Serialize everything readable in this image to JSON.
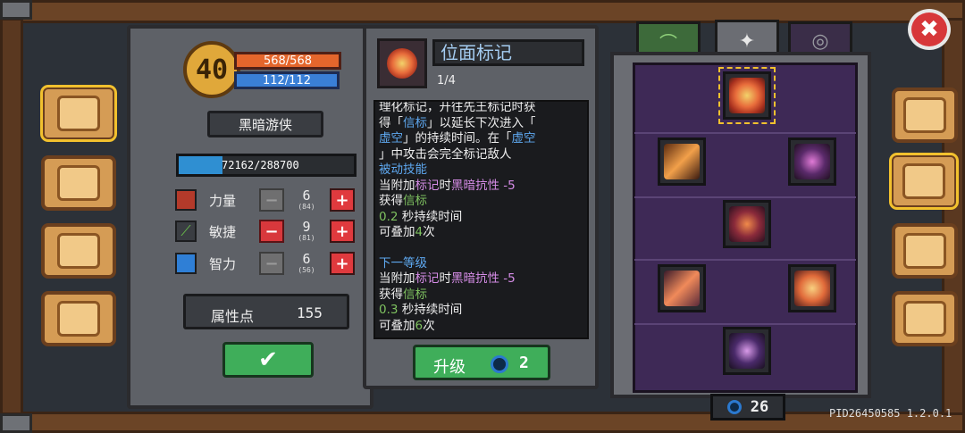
{
  "player": {
    "level": "40",
    "hp": "568/568",
    "mp": "112/112",
    "class_name": "黑暗游侠",
    "xp": "72162/288700",
    "xp_fraction": 0.25
  },
  "stats": [
    {
      "label": "力量",
      "value": "6",
      "sub": "(84)",
      "minus_active": false
    },
    {
      "label": "敏捷",
      "value": "9",
      "sub": "(81)",
      "minus_active": true
    },
    {
      "label": "智力",
      "value": "6",
      "sub": "(56)",
      "minus_active": false
    }
  ],
  "attribute_points": {
    "label": "属性点",
    "value": "155"
  },
  "confirm_icon": "✔",
  "skill": {
    "name": "位面标记",
    "level": "1/4",
    "upgrade_label": "升级",
    "upgrade_cost": "2"
  },
  "description": {
    "line1": "理化标记，开往先王标记时获",
    "line2a": "得「",
    "line2b": "信标",
    "line2c": "」以延长下次进入「",
    "line3a": "虚空",
    "line3b": "」的持续时间。在「",
    "line3c": "虚空",
    "line4": "」中攻击会完全标记敌人",
    "passive_title": "被动技能",
    "p1a": "当附加",
    "p1b": "标记",
    "p1c": "时",
    "p1d": "黑暗抗性 -5",
    "p2a": "获得",
    "p2b": "信标",
    "p3a": "0.2",
    "p3b": " 秒持续时间",
    "p4a": "可叠加",
    "p4b": "4",
    "p4c": "次",
    "next_title": "下一等级",
    "n1a": "当附加",
    "n1b": "标记",
    "n1c": "时",
    "n1d": "黑暗抗性 -5",
    "n2a": "获得",
    "n2b": "信标",
    "n3a": "0.3",
    "n3b": " 秒持续时间",
    "n4a": "可叠加",
    "n4b": "6",
    "n4c": "次"
  },
  "coins": "26",
  "version": "PID26450585 1.2.0.1",
  "close_glyph": "✖",
  "colors": {
    "accent_green": "#3fae5a",
    "panel_purple": "#3e2956",
    "close_red": "#d7373a"
  }
}
